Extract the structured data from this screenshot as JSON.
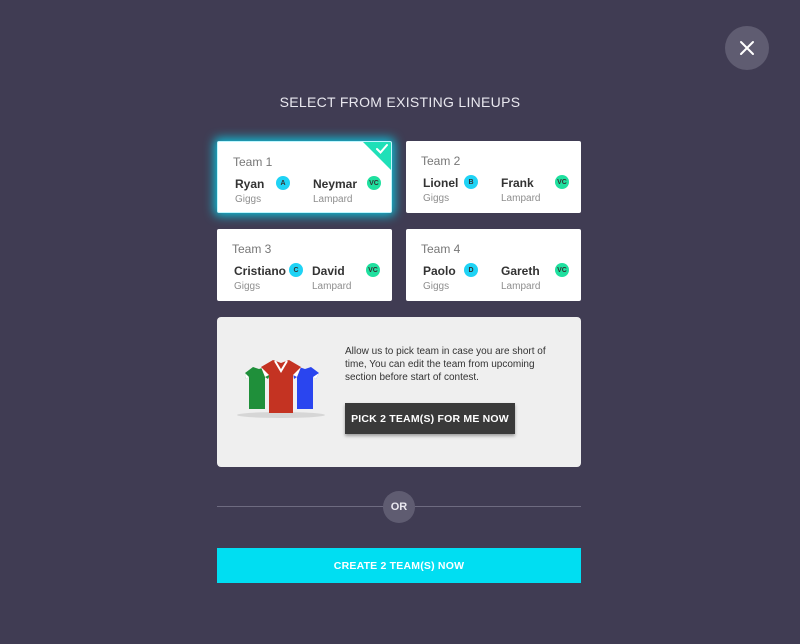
{
  "title": "SELECT FROM EXISTING LINEUPS",
  "close_icon": "close-icon",
  "teams": [
    {
      "name": "Team 1",
      "selected": true,
      "captain": {
        "first": "Ryan",
        "last": "Giggs",
        "badge": "A"
      },
      "vice": {
        "first": "Neymar",
        "last": "Lampard",
        "badge": "VC"
      }
    },
    {
      "name": "Team 2",
      "selected": false,
      "captain": {
        "first": "Lionel",
        "last": "Giggs",
        "badge": "B"
      },
      "vice": {
        "first": "Frank",
        "last": "Lampard",
        "badge": "VC"
      }
    },
    {
      "name": "Team 3",
      "selected": false,
      "captain": {
        "first": "Cristiano",
        "last": "Giggs",
        "badge": "C"
      },
      "vice": {
        "first": "David",
        "last": "Lampard",
        "badge": "VC"
      }
    },
    {
      "name": "Team 4",
      "selected": false,
      "captain": {
        "first": "Paolo",
        "last": "Giggs",
        "badge": "D"
      },
      "vice": {
        "first": "Gareth",
        "last": "Lampard",
        "badge": "VC"
      }
    }
  ],
  "auto_pick": {
    "text": "Allow us to pick team in case you are short of time, You can edit the team from upcoming section before start of contest.",
    "button": "PICK 2 TEAM(S) FOR ME NOW",
    "icon": "jerseys-icon"
  },
  "or_label": "OR",
  "create_button": "CREATE 2 TEAM(S) NOW",
  "colors": {
    "background": "#403c53",
    "accent": "#00def2",
    "captain_badge": "#1fd3f5",
    "vice_badge": "#1fe09f",
    "selected_check": "#1fe0b8"
  }
}
